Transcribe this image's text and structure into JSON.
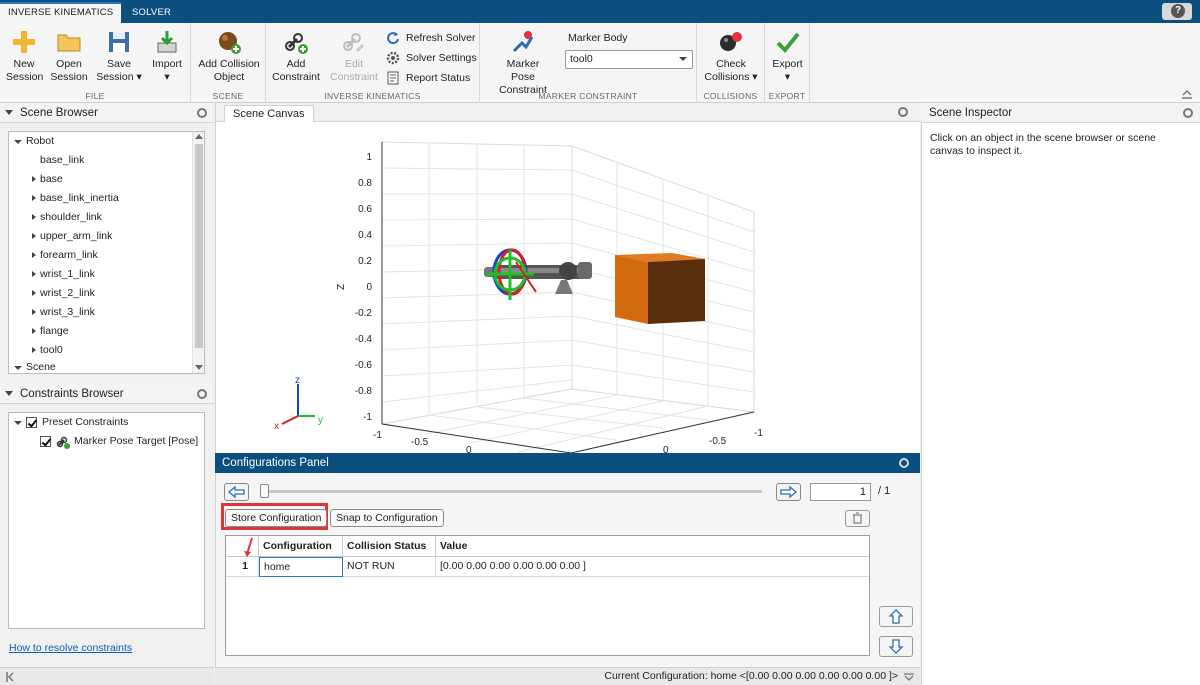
{
  "tabs": [
    {
      "label": "INVERSE KINEMATICS",
      "active": true
    },
    {
      "label": "SOLVER",
      "active": false
    }
  ],
  "ribbon": {
    "file": {
      "label": "FILE",
      "new_session": [
        "New",
        "Session"
      ],
      "open_session": [
        "Open",
        "Session"
      ],
      "save_session": [
        "Save",
        "Session"
      ],
      "import": [
        "Import"
      ]
    },
    "scene": {
      "label": "SCENE",
      "add_collision": [
        "Add Collision",
        "Object"
      ]
    },
    "ik": {
      "label": "INVERSE KINEMATICS",
      "add_constraint": [
        "Add",
        "Constraint"
      ],
      "edit_constraint": [
        "Edit",
        "Constraint"
      ],
      "refresh_solver": "Refresh Solver",
      "solver_settings": "Solver Settings",
      "report_status": "Report Status"
    },
    "marker": {
      "label": "MARKER CONSTRAINT",
      "marker_pose": [
        "Marker",
        "Pose Constraint"
      ],
      "marker_body_label": "Marker Body",
      "marker_body_value": "tool0"
    },
    "collisions": {
      "label": "COLLISIONS",
      "check": [
        "Check",
        "Collisions"
      ]
    },
    "export": {
      "label": "EXPORT",
      "export": [
        "Export"
      ]
    }
  },
  "scene_browser": {
    "title": "Scene Browser",
    "robot_label": "Robot",
    "items": [
      "base_link",
      "base",
      "base_link_inertia",
      "shoulder_link",
      "upper_arm_link",
      "forearm_link",
      "wrist_1_link",
      "wrist_2_link",
      "wrist_3_link",
      "flange",
      "tool0"
    ],
    "scene_label": "Scene"
  },
  "constraints_browser": {
    "title": "Constraints Browser",
    "group": "Preset Constraints",
    "item": "Marker Pose Target [Pose]",
    "help_link": "How to resolve constraints"
  },
  "canvas": {
    "tab": "Scene Canvas",
    "axis_label_z": "Z",
    "z_ticks": [
      "1",
      "0.8",
      "0.6",
      "0.4",
      "0.2",
      "0",
      "-0.2",
      "-0.4",
      "-0.6",
      "-0.8",
      "-1"
    ],
    "x_ticks": [
      "-1",
      "-0.5",
      "0"
    ],
    "y_ticks": [
      "0",
      "-0.5",
      "-1"
    ],
    "triad": {
      "x": "x",
      "y": "y",
      "z": "z"
    },
    "colors": {
      "box": "#d46a10",
      "box_side": "#5a2d0c",
      "box_top": "#e07b22"
    }
  },
  "inspector": {
    "title": "Scene Inspector",
    "hint": "Click on an object in the scene browser or scene canvas to inspect it."
  },
  "configurations": {
    "title": "Configurations Panel",
    "page": "1",
    "page_total": "/ 1",
    "store_button": "Store Configuration",
    "snap_button": "Snap to Configuration",
    "columns": [
      "Configuration",
      "Collision Status",
      "Value"
    ],
    "rows": [
      {
        "index": "1",
        "name": "home",
        "status": "NOT RUN",
        "value": "[0.00 0.00 0.00 0.00 0.00 0.00 ]"
      }
    ]
  },
  "status_bar": {
    "text": "Current Configuration: home <[0.00 0.00 0.00 0.00 0.00 0.00 ]>"
  }
}
